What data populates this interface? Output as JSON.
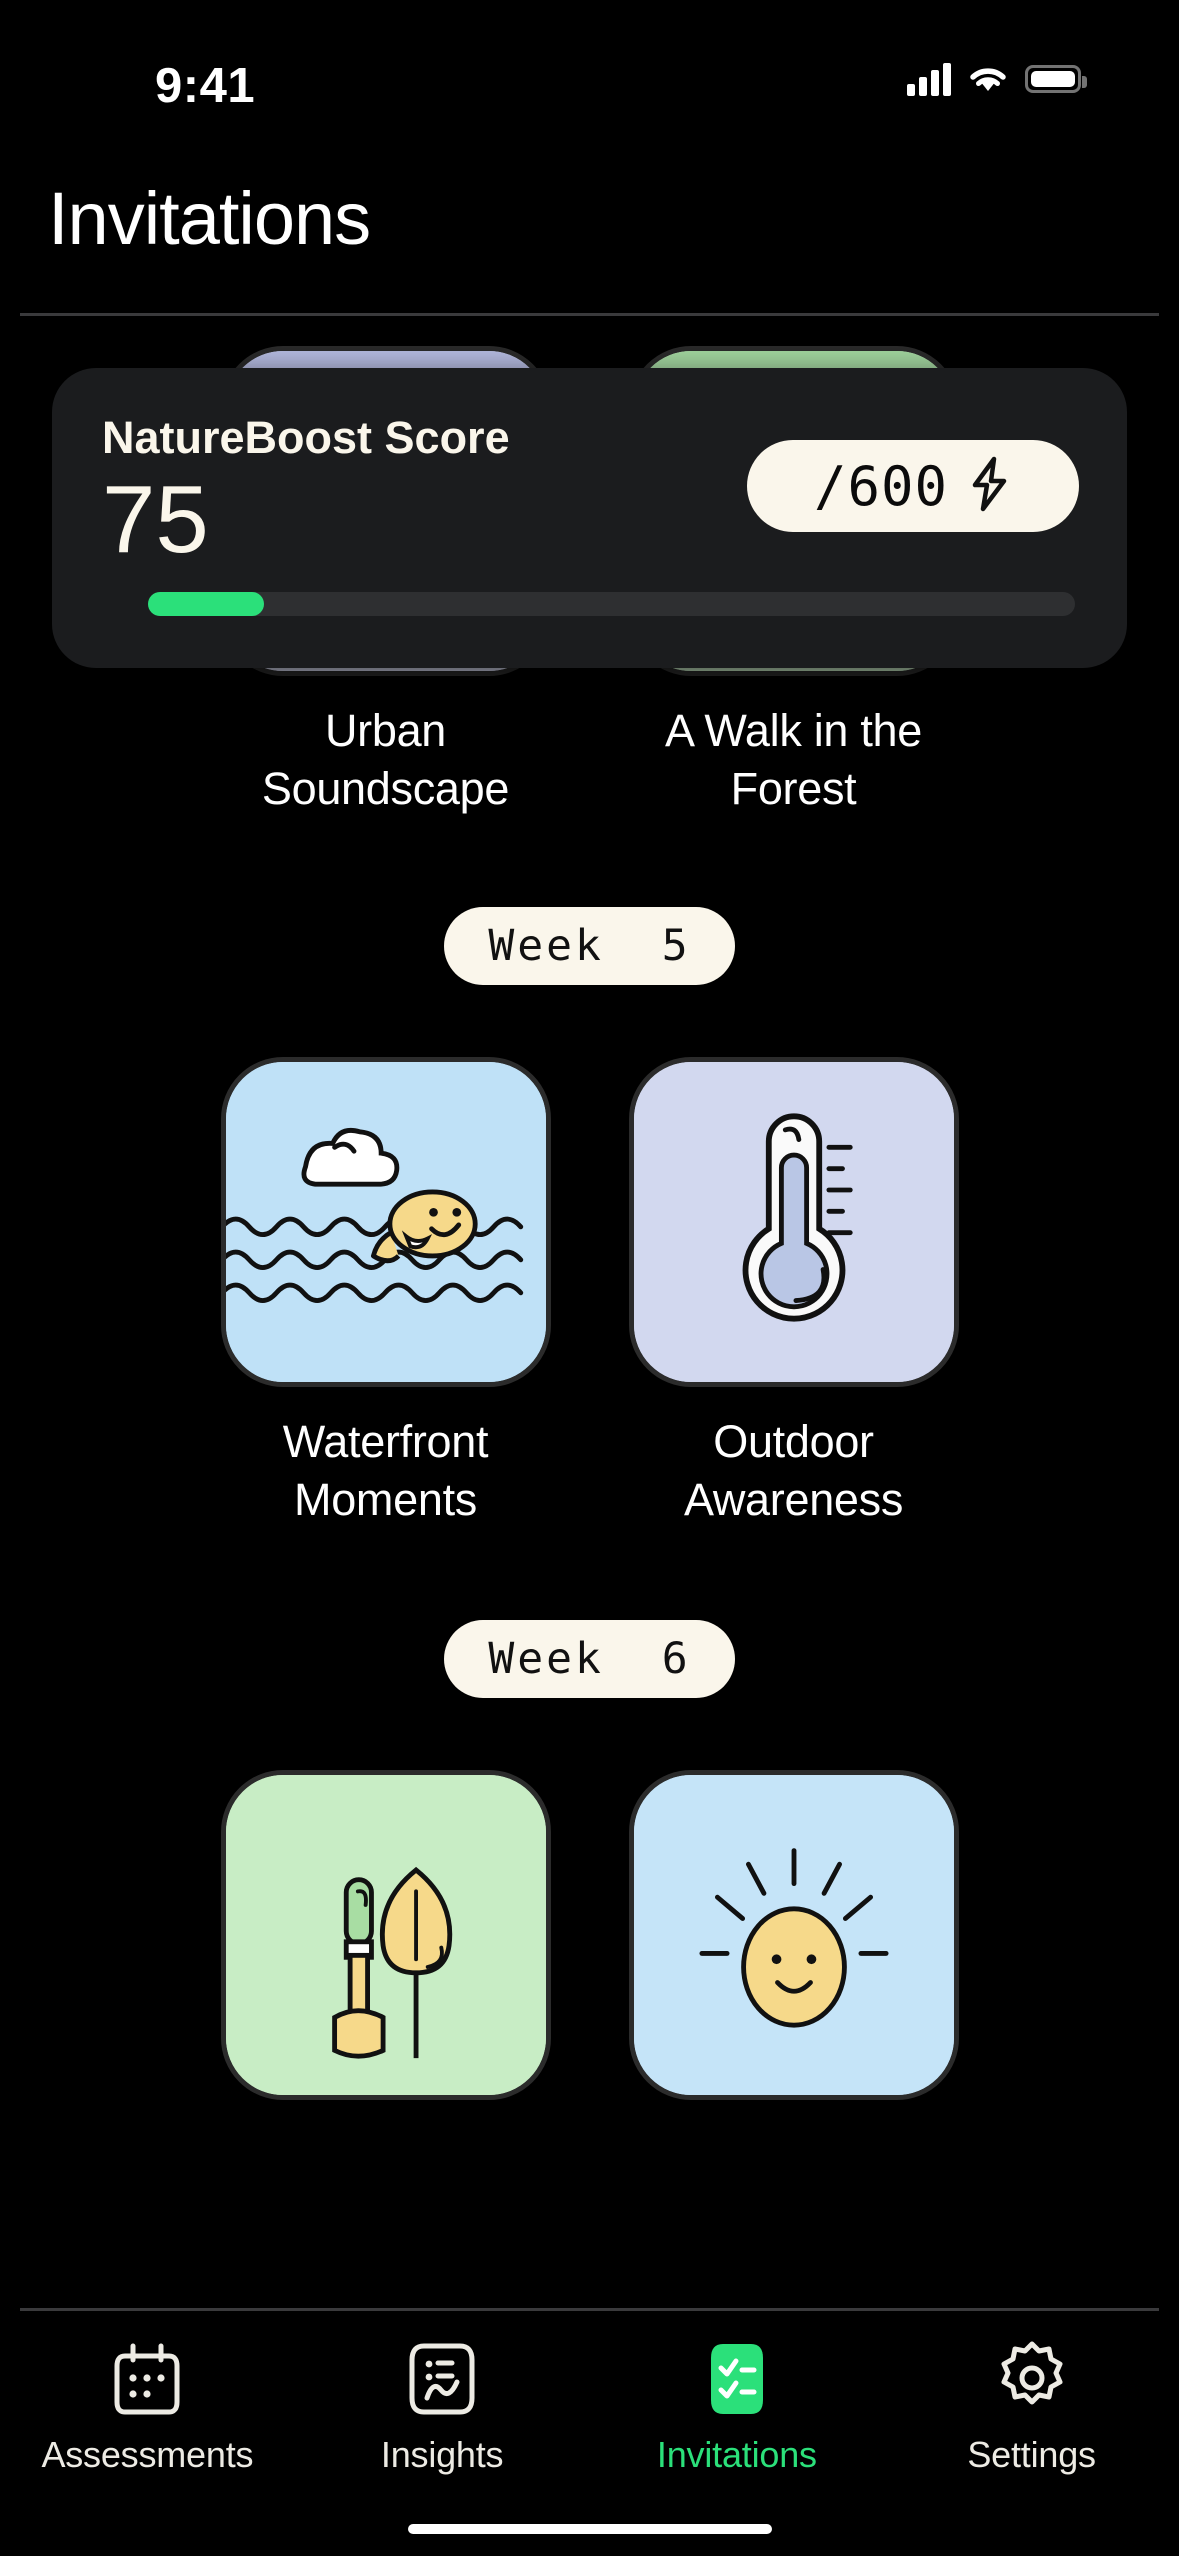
{
  "status_bar": {
    "time": "9:41",
    "cellular_icon": "cellular-bars-icon",
    "wifi_icon": "wifi-icon",
    "battery_icon": "battery-icon"
  },
  "header": {
    "title": "Invitations"
  },
  "score_card": {
    "title": "NatureBoost Score",
    "value": "75",
    "goal_label": "/600",
    "bolt_icon": "lightning-bolt-icon",
    "progress_percent": 12.5,
    "accent_color": "#2BE07A",
    "card_color": "#1B1C1E",
    "cream_color": "#FAF6EB"
  },
  "sections": [
    {
      "chip": "",
      "tiles": [
        {
          "label": "Urban Soundscape",
          "icon": "map-pin-icon",
          "bg": "#D5D8F0"
        },
        {
          "label": "A Walk in the Forest",
          "icon": "forest-trees-icon",
          "bg": "#C8EDC5"
        }
      ]
    },
    {
      "chip": "Week  5",
      "tiles": [
        {
          "label": "Waterfront Moments",
          "icon": "fish-water-icon",
          "bg": "#BFE1F7"
        },
        {
          "label": "Outdoor Awareness",
          "icon": "thermometer-icon",
          "bg": "#D2D8EF"
        }
      ]
    },
    {
      "chip": "Week  6",
      "tiles": [
        {
          "label": "",
          "icon": "garden-tools-icon",
          "bg": "#C8EDC5"
        },
        {
          "label": "",
          "icon": "sun-icon",
          "bg": "#C5E4F8"
        }
      ]
    }
  ],
  "tabbar": {
    "items": [
      {
        "label": "Assessments",
        "icon": "calendar-icon",
        "active": false
      },
      {
        "label": "Insights",
        "icon": "chart-icon",
        "active": false
      },
      {
        "label": "Invitations",
        "icon": "checklist-icon",
        "active": true
      },
      {
        "label": "Settings",
        "icon": "gear-icon",
        "active": false
      }
    ],
    "active_color": "#2BE07A"
  }
}
